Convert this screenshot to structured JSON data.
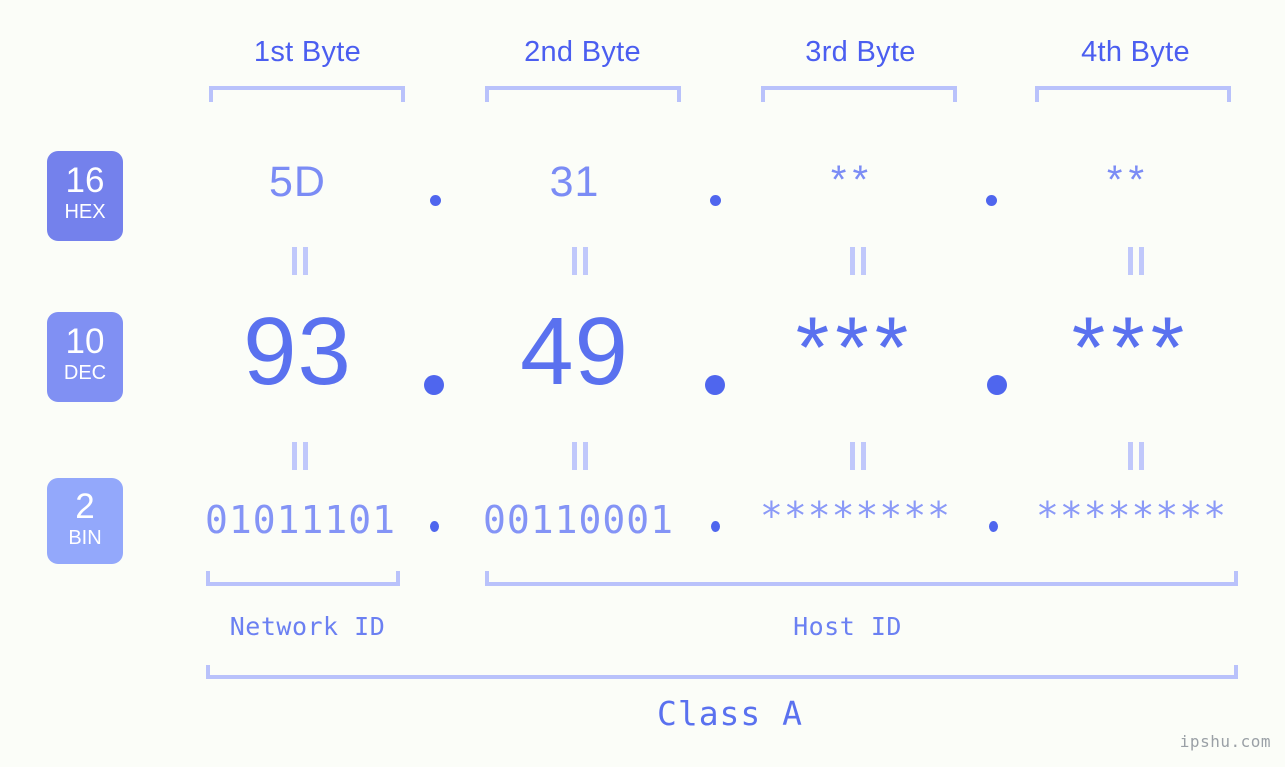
{
  "background_color": "#fbfdf8",
  "colors": {
    "header_blue": "#4b5ef0",
    "bracket_blue": "#b9c2fb",
    "hex_blue": "#7b8cf5",
    "dec_blue": "#5a71ef",
    "bin_blue": "#8494f6",
    "dot_blue": "#4f66ee",
    "badge_hex": "#7481ec",
    "badge_dec": "#8090f3",
    "badge_bin": "#93a8fb",
    "watermark_gray": "#9aa0a6"
  },
  "byte_headers": [
    {
      "label": "1st Byte"
    },
    {
      "label": "2nd Byte"
    },
    {
      "label": "3rd Byte"
    },
    {
      "label": "4th Byte"
    }
  ],
  "bases": [
    {
      "number": "16",
      "name": "HEX",
      "color": "#7481ec"
    },
    {
      "number": "10",
      "name": "DEC",
      "color": "#8090f3"
    },
    {
      "number": "2",
      "name": "BIN",
      "color": "#93a8fb"
    }
  ],
  "rows": {
    "hex": {
      "base_number": "16",
      "base_name": "HEX",
      "values": [
        "5D",
        "31",
        "**",
        "**"
      ],
      "separator": "."
    },
    "dec": {
      "base_number": "10",
      "base_name": "DEC",
      "values": [
        "93",
        "49",
        "***",
        "***"
      ],
      "separator": "."
    },
    "bin": {
      "base_number": "2",
      "base_name": "BIN",
      "values": [
        "01011101",
        "00110001",
        "********",
        "********"
      ],
      "separator": "."
    }
  },
  "sections": {
    "network_id": "Network ID",
    "host_id": "Host ID",
    "class": "Class A"
  },
  "watermark": "ipshu.com"
}
